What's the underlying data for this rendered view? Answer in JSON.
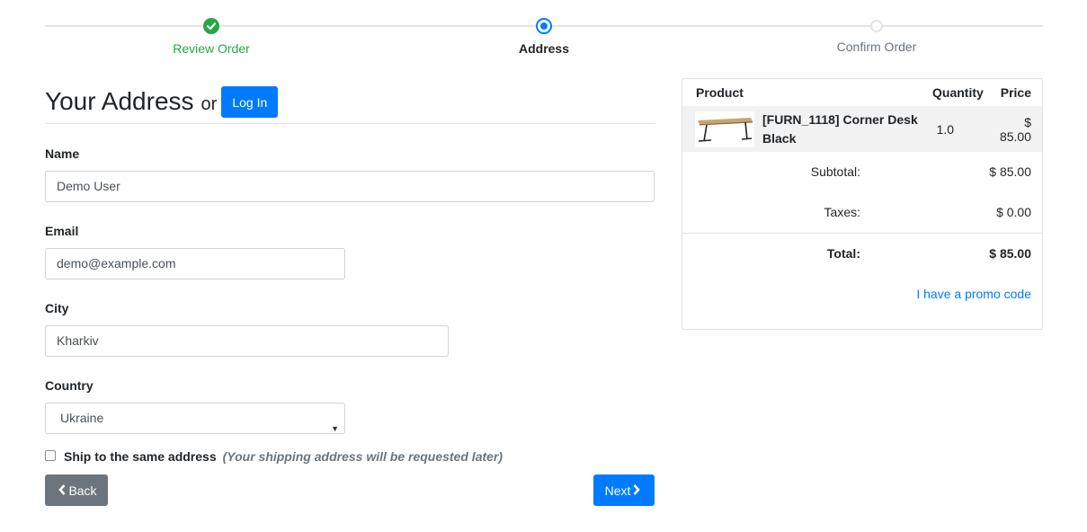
{
  "wizard": {
    "steps": [
      {
        "label": "Review Order",
        "state": "done"
      },
      {
        "label": "Address",
        "state": "current"
      },
      {
        "label": "Confirm Order",
        "state": "todo"
      }
    ]
  },
  "address_form": {
    "title": "Your Address",
    "or_text": "or",
    "login_label": "Log In",
    "name": {
      "label": "Name",
      "value": "Demo User"
    },
    "email": {
      "label": "Email",
      "value": "demo@example.com"
    },
    "city": {
      "label": "City",
      "value": "Kharkiv"
    },
    "country": {
      "label": "Country",
      "selected": "Ukraine"
    },
    "ship_same": {
      "label": "Ship to the same address",
      "note": "(Your shipping address will be requested later)",
      "checked": false
    },
    "back_label": "Back",
    "next_label": "Next"
  },
  "order_summary": {
    "headers": {
      "product": "Product",
      "quantity": "Quantity",
      "price": "Price"
    },
    "items": [
      {
        "name": "[FURN_1118] Corner Desk Black",
        "quantity": "1.0",
        "price": "$ 85.00"
      }
    ],
    "subtotal": {
      "label": "Subtotal:",
      "value": "$ 85.00"
    },
    "taxes": {
      "label": "Taxes:",
      "value": "$ 0.00"
    },
    "total": {
      "label": "Total:",
      "value": "$ 85.00"
    },
    "promo_link": "I have a promo code"
  },
  "colors": {
    "primary": "#007bff",
    "success": "#28a745",
    "secondary": "#6c757d"
  },
  "icons": {
    "done_step": "check-icon",
    "back": "chevron-left-icon",
    "next": "chevron-right-icon",
    "select": "caret-down-icon"
  }
}
